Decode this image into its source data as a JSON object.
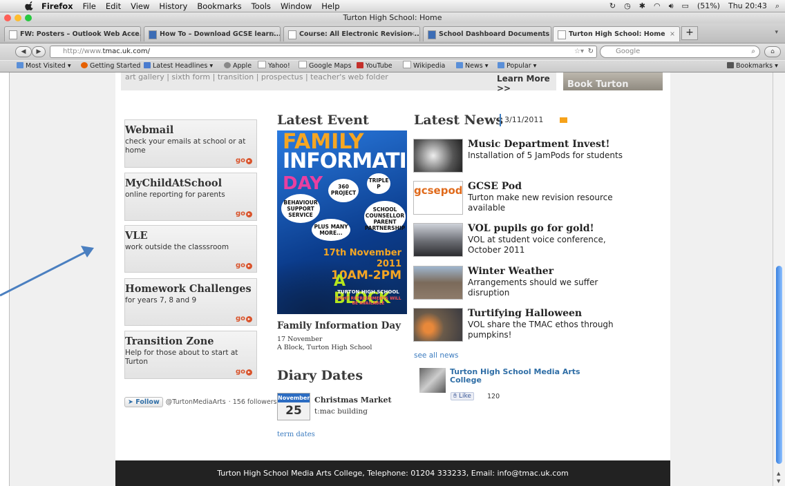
{
  "menubar": {
    "app": "Firefox",
    "items": [
      "File",
      "Edit",
      "View",
      "History",
      "Bookmarks",
      "Tools",
      "Window",
      "Help"
    ],
    "status": {
      "battery": "(51%)",
      "clock": "Thu 20:43"
    }
  },
  "window": {
    "title": "Turton High School: Home"
  },
  "tabs": [
    {
      "label": "FW: Posters – Outlook Web Acce..."
    },
    {
      "label": "How To – Download GCSE learn..."
    },
    {
      "label": "Course: All Electronic Revision ..."
    },
    {
      "label": "School Dashboard Documents –..."
    },
    {
      "label": "Turton High School: Home"
    }
  ],
  "nav": {
    "url_prefix": "http://www.",
    "url_host": "tmac.uk.com/",
    "search_placeholder": "Google"
  },
  "bookmarks": {
    "items": [
      "Most Visited",
      "Getting Started",
      "Latest Headlines",
      "Apple",
      "Yahoo!",
      "Google Maps",
      "YouTube",
      "Wikipedia",
      "News",
      "Popular"
    ],
    "right": "Bookmarks"
  },
  "page": {
    "topnav_text": "art gallery | sixth form | transition | prospectus | teacher's web folder",
    "learn_more": "Learn More >>",
    "book_turton": "Book Turton",
    "left_boxes": [
      {
        "title": "Webmail",
        "desc": "check your emails at school or at home",
        "go": "go"
      },
      {
        "title": "MyChildAtSchool",
        "desc": "online reporting for parents",
        "go": "go"
      },
      {
        "title": "VLE",
        "desc": "work outside the classsroom",
        "go": "go"
      },
      {
        "title": "Homework Challenges",
        "desc": "for years 7, 8 and 9",
        "go": "go"
      },
      {
        "title": "Transition Zone",
        "desc": "Help for those about to start at Turton",
        "go": "go"
      }
    ],
    "follow": {
      "button": "Follow",
      "handle": "@TurtonMediaArts",
      "followers": "· 156 followers"
    },
    "latest_event": {
      "heading": "Latest Event",
      "poster": {
        "line1": "FAMILY",
        "line2": "INFORMATION",
        "line3": "DAY",
        "bubbles": [
          "360 PROJECT",
          "TRIPLE P",
          "BEHAVIOUR SUPPORT SERVICE",
          "SCHOOL COUNSELLOR PARENT PARTNERSHIP",
          "PLUS MANY MORE..."
        ],
        "date": "17th November 2011",
        "time": "10AM-2PM",
        "block": "A BLOCK",
        "school": "TURTON HIGH SCHOOL",
        "refresh": "LIGHT REFRESHMENTS WILL BE AVAILABLE"
      },
      "title": "Family Information Day",
      "date": "17 November",
      "location": "A Block, Turton High School"
    },
    "diary": {
      "heading": "Diary Dates",
      "month": "November",
      "day": "25",
      "event": "Christmas Market",
      "place": "t:mac building",
      "term_dates": "term dates"
    },
    "news": {
      "heading": "Latest News",
      "date": "3/11/2011",
      "items": [
        {
          "title": "Music Department Invest!",
          "desc": "Installation of 5 JamPods for students"
        },
        {
          "title": "GCSE Pod",
          "desc": "Turton make new revision resource available"
        },
        {
          "title": "VOL pupils go for gold!",
          "desc": "VOL at student voice conference, October 2011"
        },
        {
          "title": "Winter Weather",
          "desc": "Arrangements should we suffer disruption"
        },
        {
          "title": "Turtifying Halloween",
          "desc": "VOL share the TMAC ethos through pumpkins!"
        }
      ],
      "see_all": "see all news",
      "gcsepod_logo": "gcsepod"
    },
    "facebook": {
      "name": "Turton High School Media Arts College",
      "like": "Like",
      "count": "120"
    },
    "footer": "Turton High School Media Arts College, Telephone: 01204 333233, Email: info@tmac.uk.com"
  },
  "colors": {
    "accent_go": "#d9532b",
    "link": "#3b7bbf",
    "footer_bg": "#222222",
    "scroll_thumb": "#3a82e0"
  }
}
